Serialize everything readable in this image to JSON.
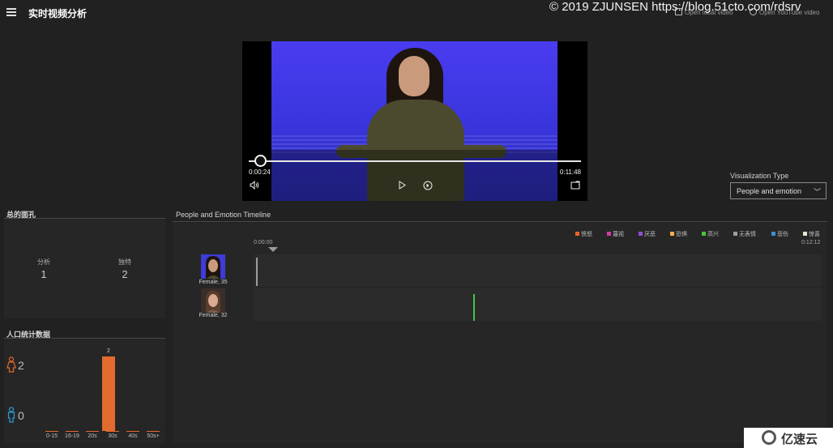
{
  "header": {
    "title": "实时视频分析",
    "watermark": "© 2019 ZJUNSEN https://blog.51cto.com/rdsrv",
    "link_local": "Open local video",
    "link_youtube": "Open YouTube video",
    "logo_text": "亿速云"
  },
  "player": {
    "current_time": "0:00:24",
    "duration": "0:11:48",
    "progress": 0.034
  },
  "visualization": {
    "label": "Visualization Type",
    "selected": "People and emotion"
  },
  "faces_panel": {
    "title": "总的面孔",
    "analyzed_label": "分析",
    "analyzed_value": "1",
    "unique_label": "独特",
    "unique_value": "2"
  },
  "demographics": {
    "title": "人口统计数据",
    "female_count": "2",
    "male_count": "0",
    "colors": {
      "female": "#e36a2e",
      "male": "#2a9fd6",
      "bar": "#e36a2e"
    }
  },
  "chart_data": {
    "type": "bar",
    "categories": [
      "0-15",
      "16-19",
      "20s",
      "30s",
      "40s",
      "50s+"
    ],
    "values": [
      0,
      0,
      0,
      2,
      0,
      0
    ],
    "data_labels": [
      "",
      "",
      "",
      "2",
      "",
      ""
    ],
    "ylim": [
      0,
      2
    ]
  },
  "timeline": {
    "title": "People and Emotion Timeline",
    "start_time": "0:00:00",
    "end_time": "0:12:12",
    "legend": [
      {
        "label": "愤怒",
        "color": "#e8622d"
      },
      {
        "label": "蔑视",
        "color": "#d63aa5"
      },
      {
        "label": "厌恶",
        "color": "#8e4fd6"
      },
      {
        "label": "恐惧",
        "color": "#f3b04a"
      },
      {
        "label": "高兴",
        "color": "#45c43c"
      },
      {
        "label": "无表情",
        "color": "#9d9d9d"
      },
      {
        "label": "悲伤",
        "color": "#3a8fd6"
      },
      {
        "label": "惊喜",
        "color": "#e9e2cf"
      }
    ],
    "people": [
      {
        "name": "Female, 35",
        "marker_color": "#9d9d9d",
        "marker_fraction": 0.004
      },
      {
        "name": "Female, 32",
        "marker_color": "#45c43c",
        "marker_fraction": 0.387
      }
    ]
  }
}
